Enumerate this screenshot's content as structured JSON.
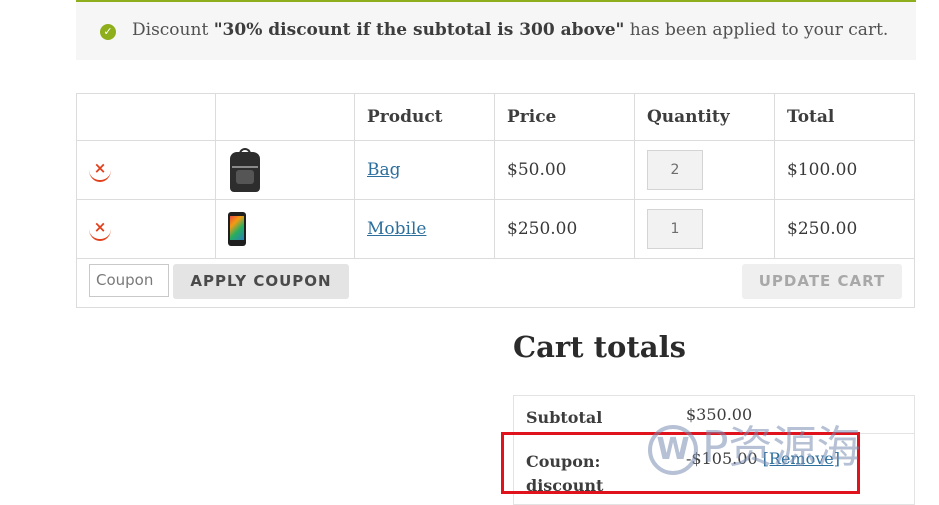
{
  "notice": {
    "prefix": "Discount ",
    "coupon_name": "\"30% discount if the subtotal is 300 above\"",
    "suffix": " has been applied to your cart."
  },
  "cart": {
    "headers": [
      "",
      "",
      "Product",
      "Price",
      "Quantity",
      "Total"
    ],
    "items": [
      {
        "product": "Bag",
        "price": "$50.00",
        "quantity": "2",
        "total": "$100.00",
        "remove": "×"
      },
      {
        "product": "Mobile",
        "price": "$250.00",
        "quantity": "1",
        "total": "$250.00",
        "remove": "×"
      }
    ],
    "coupon_placeholder": "Coupon",
    "apply_coupon_label": "APPLY COUPON",
    "update_cart_label": "UPDATE CART"
  },
  "totals": {
    "title": "Cart totals",
    "subtotal_label": "Subtotal",
    "subtotal_value": "$350.00",
    "coupon_label_line1": "Coupon:",
    "coupon_label_line2": "discount",
    "coupon_value": "-$105.00",
    "remove_label": "[Remove]"
  },
  "watermark": {
    "logo_letter": "W",
    "text": "P资源海"
  },
  "colors": {
    "success": "#8fae1b",
    "remove": "#e2401c",
    "link": "#2c6e9c",
    "highlight": "#e0121b"
  }
}
